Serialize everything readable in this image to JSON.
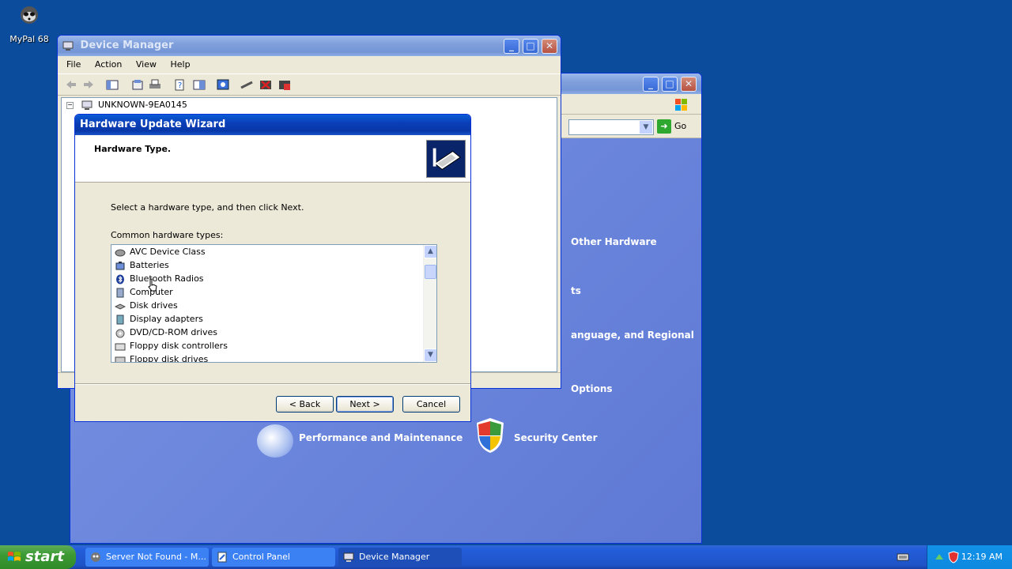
{
  "desktop": {
    "icon_label": "MyPal 68"
  },
  "control_panel": {
    "go_label": "Go",
    "categories": [
      "Other Hardware",
      "ts",
      "anguage, and Regional",
      "Options",
      "Performance and Maintenance",
      "Security Center"
    ]
  },
  "device_manager": {
    "title": "Device Manager",
    "menu": [
      "File",
      "Action",
      "View",
      "Help"
    ],
    "tree_root": "UNKNOWN-9EA0145"
  },
  "wizard": {
    "title": "Hardware Update Wizard",
    "heading": "Hardware Type.",
    "instruction": "Select a hardware type, and then click Next.",
    "list_label": "Common hardware types:",
    "items": [
      "AVC Device Class",
      "Batteries",
      "Bluetooth Radios",
      "Computer",
      "Disk drives",
      "Display adapters",
      "DVD/CD-ROM drives",
      "Floppy disk controllers",
      "Floppy disk drives"
    ],
    "back_label": "< Back",
    "next_label": "Next >",
    "cancel_label": "Cancel"
  },
  "taskbar": {
    "start_label": "start",
    "tasks": [
      "Server Not Found - M...",
      "Control Panel",
      "Device Manager"
    ],
    "clock": "12:19 AM"
  }
}
